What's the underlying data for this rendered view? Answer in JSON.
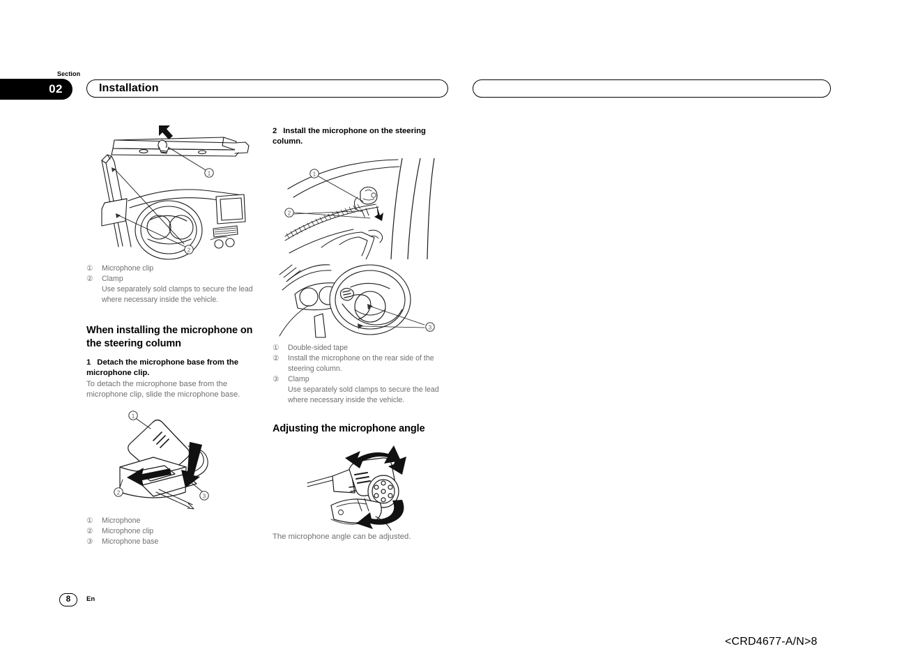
{
  "header": {
    "section_label": "Section",
    "section_number": "02",
    "title": "Installation",
    "right_bar_text": ""
  },
  "left_column": {
    "figure1": {
      "name": "windshield-visor-microphone-clip-figure",
      "callouts": [
        "1",
        "2"
      ]
    },
    "legend1": [
      {
        "marker": "①",
        "text": "Microphone clip",
        "sub": ""
      },
      {
        "marker": "②",
        "text": "Clamp",
        "sub": "Use separately sold clamps to secure the lead where necessary inside the vehicle."
      }
    ],
    "heading": "When installing the microphone on the steering column",
    "step1": {
      "number": "1",
      "text": "Detach the microphone base from the microphone clip."
    },
    "step1_body": "To detach the microphone base from the microphone clip, slide the microphone base.",
    "figure2": {
      "name": "microphone-base-detach-figure",
      "callouts": [
        "1",
        "2",
        "3"
      ]
    },
    "legend2": [
      {
        "marker": "①",
        "text": "Microphone",
        "sub": ""
      },
      {
        "marker": "②",
        "text": "Microphone clip",
        "sub": ""
      },
      {
        "marker": "③",
        "text": "Microphone base",
        "sub": ""
      }
    ]
  },
  "mid_column": {
    "step2": {
      "number": "2",
      "text": "Install the microphone on the steering column."
    },
    "figure3": {
      "name": "steering-column-upper-figure",
      "callouts": [
        "1",
        "2"
      ]
    },
    "figure4": {
      "name": "steering-wheel-clamp-figure",
      "callouts": [
        "3"
      ]
    },
    "legend3": [
      {
        "marker": "①",
        "text": "Double-sided tape",
        "sub": ""
      },
      {
        "marker": "②",
        "text": "Install the microphone on the rear side of the steering column.",
        "sub": ""
      },
      {
        "marker": "③",
        "text": "Clamp",
        "sub": "Use separately sold clamps to secure the lead where necessary inside the vehicle."
      }
    ],
    "heading2": "Adjusting the microphone angle",
    "figure5": {
      "name": "microphone-angle-adjust-figure",
      "callouts": []
    },
    "caption": "The microphone angle can be adjusted."
  },
  "footer": {
    "page_number": "8",
    "language": "En",
    "doc_code": "<CRD4677-A/N>8"
  }
}
